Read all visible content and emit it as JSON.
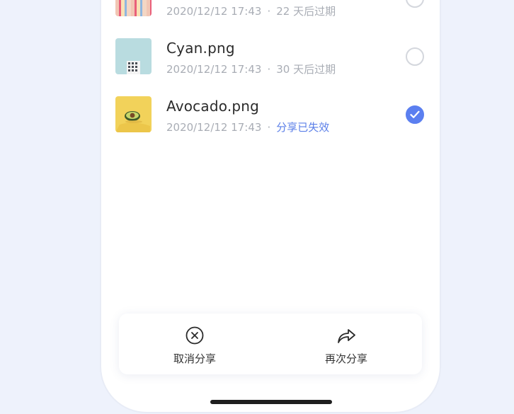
{
  "files": [
    {
      "name": "",
      "date": "2020/12/12 17:43",
      "status": "22 天后过期",
      "selected": false,
      "thumb": "stripes"
    },
    {
      "name": "Cyan.png",
      "date": "2020/12/12 17:43",
      "status": "30 天后过期",
      "selected": false,
      "thumb": "cyan-building"
    },
    {
      "name": "Avocado.png",
      "date": "2020/12/12 17:43",
      "status": "分享已失效",
      "selected": true,
      "thumb": "avocado"
    }
  ],
  "actions": {
    "cancel_share": {
      "label": "取消分享",
      "icon": "close-circle-icon"
    },
    "share_again": {
      "label": "再次分享",
      "icon": "share-arrow-icon"
    }
  },
  "colors": {
    "accent": "#5b7ff0",
    "expired_text": "#5b7fe8",
    "page_bg": "#eef2fc"
  }
}
